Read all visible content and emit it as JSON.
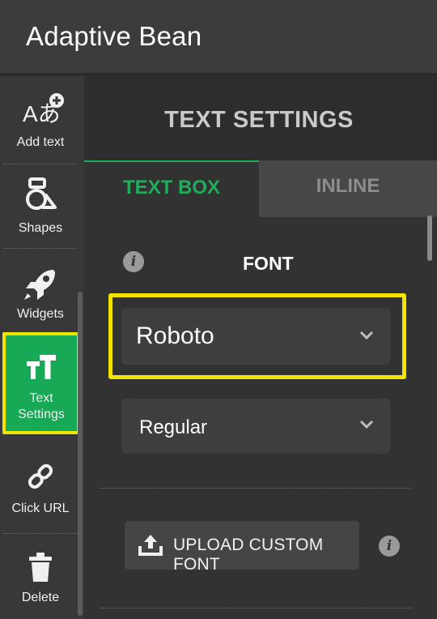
{
  "app": {
    "title": "Adaptive Bean"
  },
  "sidebar": {
    "items": [
      {
        "label": "Add text",
        "icon": "add-text-icon"
      },
      {
        "label": "Shapes",
        "icon": "shapes-icon"
      },
      {
        "label": "Widgets",
        "icon": "rocket-icon"
      },
      {
        "label": "Text Settings",
        "label_line1": "Text",
        "label_line2": "Settings",
        "icon": "text-settings-icon",
        "active": true
      },
      {
        "label": "Click URL",
        "icon": "link-icon"
      },
      {
        "label": "Delete",
        "icon": "trash-icon"
      }
    ]
  },
  "panel": {
    "header": "TEXT SETTINGS",
    "tabs": [
      {
        "label": "TEXT BOX",
        "active": true
      },
      {
        "label": "INLINE",
        "active": false
      }
    ],
    "font": {
      "label": "FONT",
      "family": "Roboto",
      "weight": "Regular"
    },
    "upload_label": "UPLOAD CUSTOM FONT"
  },
  "colors": {
    "accent": "#1fad5b",
    "highlight": "#f3e400",
    "background": "#323232"
  }
}
